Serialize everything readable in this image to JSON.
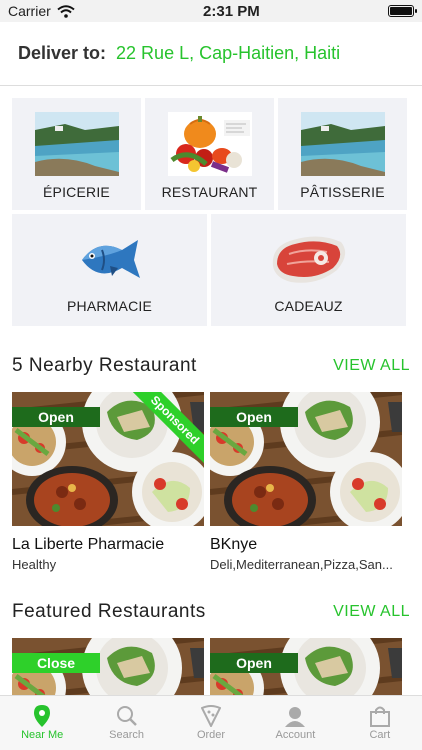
{
  "status": {
    "carrier": "Carrier",
    "time": "2:31 PM"
  },
  "deliver": {
    "label": "Deliver to:",
    "address": "22 Rue L, Cap-Haitien, Haiti"
  },
  "categories": [
    {
      "label": "ÉPICERIE",
      "icon": "beach-photo"
    },
    {
      "label": "RESTAURANT",
      "icon": "vegetables-photo"
    },
    {
      "label": "PÂTISSERIE",
      "icon": "beach-photo"
    },
    {
      "label": "PHARMACIE",
      "icon": "fish-icon"
    },
    {
      "label": "CADEAUZ",
      "icon": "steak-icon"
    }
  ],
  "nearby": {
    "title": "5 Nearby Restaurant",
    "view_all": "VIEW ALL",
    "cards": [
      {
        "status": "Open",
        "sponsored": "Sponsored",
        "name": "La Liberte Pharmacie",
        "subtitle": "Healthy"
      },
      {
        "status": "Open",
        "name": "BKnye",
        "subtitle": "Deli,Mediterranean,Pizza,San..."
      }
    ]
  },
  "featured": {
    "title": "Featured Restaurants",
    "view_all": "VIEW ALL",
    "cards": [
      {
        "status": "Close"
      },
      {
        "status": "Open"
      }
    ]
  },
  "tabs": [
    {
      "label": "Near Me",
      "icon": "location-pin-icon",
      "active": true
    },
    {
      "label": "Search",
      "icon": "search-icon",
      "active": false
    },
    {
      "label": "Order",
      "icon": "pizza-icon",
      "active": false
    },
    {
      "label": "Account",
      "icon": "user-icon",
      "active": false
    },
    {
      "label": "Cart",
      "icon": "shopping-bag-icon",
      "active": false
    }
  ],
  "colors": {
    "accent": "#27c32d",
    "open_badge": "#1e6b1c",
    "close_badge": "#2ed02a",
    "tile_bg": "#f1f2f6"
  }
}
